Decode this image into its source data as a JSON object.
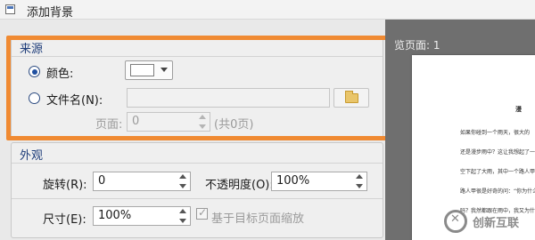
{
  "window": {
    "title": "添加背景"
  },
  "source": {
    "group_title": "来源",
    "color_label": "颜色:",
    "file_label": "文件名(N):",
    "file_value": "",
    "page_label": "页面:",
    "page_value": "0",
    "page_total": "(共0页)",
    "selected": "color",
    "color_value": "#ffffff"
  },
  "appearance": {
    "group_title": "外观",
    "rotate_label": "旋转(R):",
    "rotate_value": "0",
    "opacity_label": "不透明度(O):",
    "opacity_value": "100%",
    "size_label": "尺寸(E):",
    "size_value": "100%",
    "scale_checkbox_label": "基于目标页面缩放",
    "scale_checked": true
  },
  "preview": {
    "label": "览页面: 1",
    "lines": [
      "如果你碰到一个雨天，很大的",
      "还是漫步雨中？这让我想起了一",
      "空下起了大雨，其中一个路人甲",
      "路人甲很是好奇的问：“你为什么",
      "吗？我然都跟在雨中，我又为什么"
    ],
    "heading": "漫"
  },
  "watermark": {
    "text": "创新互联"
  },
  "colors": {
    "highlight_border": "#f08a32",
    "group_title": "#1e3d7a"
  }
}
